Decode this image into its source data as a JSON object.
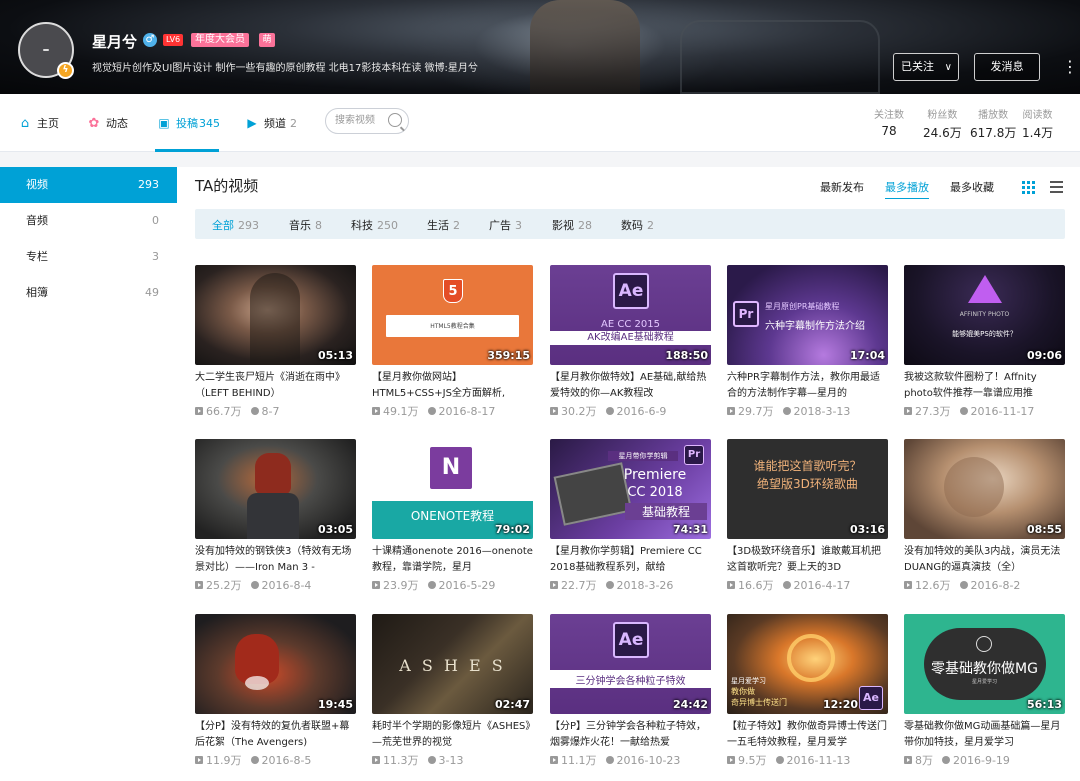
{
  "profile": {
    "name": "星月兮",
    "gender_icon": "male-icon",
    "level": "LV6",
    "vip_label": "年度大会员",
    "vip_icon": "萌",
    "sign": "视觉短片创作及UI图片设计 制作一些有趣的原创教程 北电17影技本科在读 微博:星月兮",
    "follow_label": "已关注",
    "message_label": "发消息"
  },
  "nav": {
    "items": [
      {
        "label": "主页",
        "count": "",
        "icon": "home-icon"
      },
      {
        "label": "动态",
        "count": "",
        "icon": "dynamic-icon"
      },
      {
        "label": "投稿",
        "count": "345",
        "icon": "upload-icon"
      },
      {
        "label": "频道",
        "count": "2",
        "icon": "channel-icon"
      }
    ],
    "search_placeholder": "搜索视频",
    "stats": [
      {
        "label": "关注数",
        "value": "78"
      },
      {
        "label": "粉丝数",
        "value": "24.6万"
      },
      {
        "label": "播放数",
        "value": "617.8万"
      },
      {
        "label": "阅读数",
        "value": "1.4万"
      }
    ]
  },
  "sidebar": {
    "items": [
      {
        "label": "视频",
        "count": "293"
      },
      {
        "label": "音频",
        "count": "0"
      },
      {
        "label": "专栏",
        "count": "3"
      },
      {
        "label": "相簿",
        "count": "49"
      }
    ]
  },
  "main": {
    "title": "TA的视频",
    "sorts": [
      "最新发布",
      "最多播放",
      "最多收藏"
    ],
    "filters": [
      {
        "label": "全部",
        "count": "293"
      },
      {
        "label": "音乐",
        "count": "8"
      },
      {
        "label": "科技",
        "count": "250"
      },
      {
        "label": "生活",
        "count": "2"
      },
      {
        "label": "广告",
        "count": "3"
      },
      {
        "label": "影视",
        "count": "28"
      },
      {
        "label": "数码",
        "count": "2"
      }
    ],
    "videos": [
      {
        "duration": "05:13",
        "title": "大二学生丧尸短片《消逝在雨中》（LEFT BEHIND）",
        "plays": "66.7万",
        "date": "8-7"
      },
      {
        "duration": "359:15",
        "title": "【星月教你做网站】HTML5+CSS+JS全方面解析,",
        "plays": "49.1万",
        "date": "2016-8-17",
        "thumb_text": "HTML5教程合集"
      },
      {
        "duration": "188:50",
        "title": "【星月教你做特效】AE基础,献给热爱特效的你—AK教程改",
        "plays": "30.2万",
        "date": "2016-6-9",
        "thumb_text": "AE CC 2015",
        "thumb_text2": "AK改编AE基础教程"
      },
      {
        "duration": "17:04",
        "title": "六种PR字幕制作方法，教你用最适合的方法制作字幕—星月的",
        "plays": "29.7万",
        "date": "2018-3-13",
        "thumb_text": "星月原创PR基础教程",
        "thumb_text2": "六种字幕制作方法介绍"
      },
      {
        "duration": "09:06",
        "title": "我被这款软件圈粉了！Affnity photo软件推荐一靠谱应用推",
        "plays": "27.3万",
        "date": "2016-11-17",
        "thumb_text": "AFFINITY PHOTO",
        "thumb_text2": "能够媲美PS的软件？"
      },
      {
        "duration": "03:05",
        "title": "没有加特效的钢铁侠3（特效有无场景对比）——Iron Man 3 -",
        "plays": "25.2万",
        "date": "2016-8-4"
      },
      {
        "duration": "79:02",
        "title": "十课精通onenote 2016—onenote教程，靠谱学院，星月",
        "plays": "23.9万",
        "date": "2016-5-29",
        "thumb_text": "ONENOTE教程"
      },
      {
        "duration": "74:31",
        "title": "【星月教你学剪辑】Premiere CC 2018基础教程系列，献给",
        "plays": "22.7万",
        "date": "2018-3-26",
        "thumb_text": "星月带你学剪辑",
        "thumb_text2": "Premiere",
        "thumb_text3": "CC 2018",
        "thumb_text4": "基础教程"
      },
      {
        "duration": "03:16",
        "title": "【3D极致环绕音乐】谁敢戴耳机把这首歌听完？要上天的3D",
        "plays": "16.6万",
        "date": "2016-4-17",
        "thumb_text": "谁能把这首歌听完？",
        "thumb_text2": "绝望版3D环绕歌曲"
      },
      {
        "duration": "08:55",
        "title": "没有加特效的美队3内战，演员无法DUANG的逼真演技（全）",
        "plays": "12.6万",
        "date": "2016-8-2"
      },
      {
        "duration": "19:45",
        "title": "【分P】没有特效的复仇者联盟+幕后花絮（The Avengers)",
        "plays": "11.9万",
        "date": "2016-8-5"
      },
      {
        "duration": "02:47",
        "title": "耗时半个学期的影像短片《ASHES》—荒芜世界的视觉",
        "plays": "11.3万",
        "date": "3-13",
        "thumb_text": "A S H E S"
      },
      {
        "duration": "24:42",
        "title": "【分P】三分钟学会各种粒子特效，烟雾爆炸火花！一献给热爱",
        "plays": "11.1万",
        "date": "2016-10-23",
        "thumb_text": "三分钟学会各种粒子特效"
      },
      {
        "duration": "12:20",
        "title": "【粒子特效】教你做奇异博士传送门一五毛特效教程，星月爱学",
        "plays": "9.5万",
        "date": "2016-11-13",
        "thumb_text": "星月爱学习",
        "thumb_text2": "教你做",
        "thumb_text3": "奇异博士传送门"
      },
      {
        "duration": "56:13",
        "title": "零基础教你做MG动画基础篇—星月带你加特技，星月爱学习",
        "plays": "8万",
        "date": "2016-9-19",
        "thumb_text": "零基础教你做MG",
        "thumb_text2": "星月爱学习"
      }
    ]
  }
}
